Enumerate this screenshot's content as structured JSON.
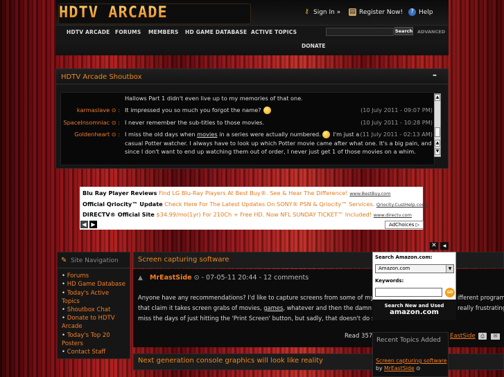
{
  "header": {
    "logo_text": "HDTV ARCADE",
    "sign_in": "Sign In »",
    "register": "Register Now!",
    "help": "Help"
  },
  "nav": {
    "items": [
      "HDTV ARCADE",
      "FORUMS",
      "MEMBERS",
      "HD GAME DATABASE",
      "ACTIVE TOPICS"
    ],
    "search_button": "Search",
    "advanced": "ADVANCED",
    "donate": "DONATE"
  },
  "shoutbox": {
    "title": "HDTV Arcade Shoutbox",
    "minimize": "–",
    "messages": [
      {
        "user": "",
        "text": "Hallows Part 1 didn't even live up to my memories of that one.",
        "time": ""
      },
      {
        "user": "karmaslave ⊙ :",
        "text": "It impressed you so much you forgot the name?",
        "time": "(10 July 2011 - 09:07 PM)"
      },
      {
        "user": "SpaceInsomniac ⊙ :",
        "text": "I never remember the sub-titles to those movies.",
        "time": "(10 July 2011 - 10:28 PM)"
      },
      {
        "user": "Goldenheart ⊙ :",
        "text_a": "I miss the old days when ",
        "link": "movies",
        "text_b": " in a series were actually numbered.",
        "text_c": " I'm just a",
        "line2": "casual Potter watcher. I always have to look up which Potter movie came after what one. It's a big pain, and",
        "line3": "since I don't want to end up watching them out of order, I never just get 1 of those movies on a whim.",
        "time": "(11 July 2011 - 02:13 AM)"
      }
    ]
  },
  "ad": {
    "row1_title": "Blu Ray Player Reviews",
    "row1_text": "Find LG Blu-Ray Players At Best Buy®. See & Hear The Difference!",
    "row1_url": "www.BestBuy.com",
    "row2_title": "Official Qriocity™ Update",
    "row2_text": "Check Here For The Latest Updates On SONY® PSN & Qriocity™ Services.",
    "row2_url": "Qriocity.CustHelp.com/",
    "row3_title": "DIRECTV® Official Site",
    "row3_text": "$34.99/mo(1yr) For 210Ch + Free HD. Now NFL SUNDAY TICKET™ Included!",
    "row3_url": "www.directv.com",
    "prev": "◀",
    "next": "▶",
    "adchoices": "AdChoices ▷"
  },
  "sidenav": {
    "title": "Site Navigation",
    "items": [
      "Forums",
      "HD Game Database",
      "Today's Active",
      "Topics",
      "Shoutbox Chat",
      "Donate to HDTV",
      "Arcade",
      "Today's Top 20",
      "Posters",
      "Contact Staff"
    ]
  },
  "post1": {
    "title": "Screen capturing software",
    "author": "MrEastSide",
    "meta": " ⊙ - 07-05-11 20:44 - 12 comments",
    "line1": "Anyone have any recommendations? I'd like to capture screens from some of my Blu",
    "line2a": "that claim it takes screen grabs of movies, ",
    "line2link": "games",
    "line2b": ", whatever and then the damn progr",
    "line3": "miss the days of just hitting the 'Print Screen' button, but sadly, that doesn't do shit o",
    "right1": "ifferent programs",
    "right2": "really frustrating.",
    "read": "Read 357"
  },
  "post2": {
    "title": "Next generation console graphics will look like reality"
  },
  "amazon": {
    "search_label": "Search Amazon.com:",
    "select_value": "Amazon.com",
    "keywords_label": "Keywords:",
    "go": "GO",
    "tagline": "Search New and Used",
    "logo": "amazon.com",
    "close": "✕",
    "arrow": "◀"
  },
  "recent": {
    "title": "Recent Topics Added",
    "topic": "Screen capturing software",
    "by": "by ",
    "author": "MrEastSide",
    "right_author": "EastSide"
  }
}
